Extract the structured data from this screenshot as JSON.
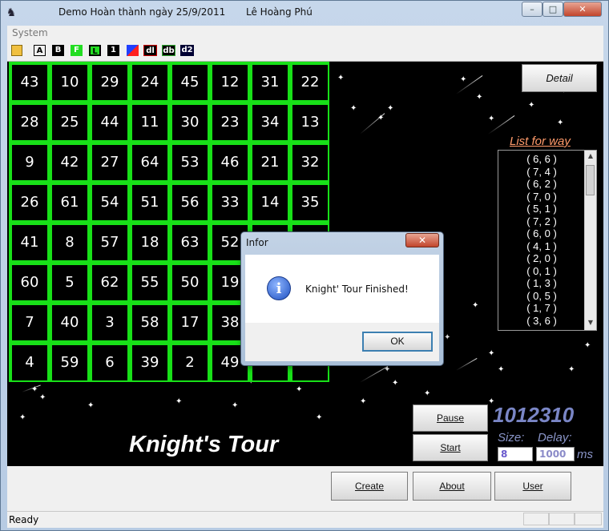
{
  "window": {
    "title_left": "Demo Hoàn thành ngày 25/9/2011",
    "title_author": "Lê Hoàng Phú",
    "minimize": "–",
    "maximize": "□",
    "close": "✕"
  },
  "menu": {
    "system": "System"
  },
  "toolbar": {
    "buttons": [
      {
        "label": "",
        "icon": "open-folder-icon"
      },
      {
        "label": "A",
        "fg": "#000000",
        "bg": "#ffffff"
      },
      {
        "label": "B",
        "fg": "#ffffff",
        "bg": "#000000"
      },
      {
        "label": "F",
        "fg": "#ffffff",
        "bg": "#22dd22"
      },
      {
        "label": "L",
        "fg": "#000000",
        "bg": "#22dd22"
      },
      {
        "label": "1",
        "fg": "#ffffff",
        "bg": "#000000"
      },
      {
        "label": "",
        "icon": "color-square-icon"
      },
      {
        "label": "dl",
        "fg": "#ffffff",
        "bg": "#990000"
      },
      {
        "label": "db",
        "fg": "#ffffff",
        "bg": "#225522"
      },
      {
        "label": "d2",
        "fg": "#ffffff",
        "bg": "#000033"
      }
    ]
  },
  "board": {
    "rows": [
      [
        43,
        10,
        29,
        24,
        45,
        12,
        31,
        22
      ],
      [
        28,
        25,
        44,
        11,
        30,
        23,
        34,
        13
      ],
      [
        9,
        42,
        27,
        64,
        53,
        46,
        21,
        32
      ],
      [
        26,
        61,
        54,
        51,
        56,
        33,
        14,
        35
      ],
      [
        41,
        8,
        57,
        18,
        63,
        52,
        "",
        ""
      ],
      [
        60,
        5,
        62,
        55,
        50,
        19,
        "",
        ""
      ],
      [
        7,
        40,
        3,
        58,
        17,
        38,
        "",
        ""
      ],
      [
        4,
        59,
        6,
        39,
        2,
        49,
        "",
        ""
      ]
    ],
    "grid_color": "#18e018"
  },
  "detail_button": "Detail",
  "list": {
    "title": "List for way",
    "items": [
      "( 6, 6 )",
      "( 7, 4 )",
      "( 6, 2 )",
      "( 7, 0 )",
      "( 5, 1 )",
      "( 7, 2 )",
      "( 6, 0 )",
      "( 4, 1 )",
      "( 2, 0 )",
      "( 0, 1 )",
      "( 1, 3 )",
      "( 0, 5 )",
      "( 1, 7 )",
      "( 3, 6 )"
    ]
  },
  "app_title": "Knight's Tour",
  "controls": {
    "pause": "Pause",
    "start": "Start",
    "counter": "1012310",
    "size_label": "Size:",
    "size_value": "8",
    "delay_label": "Delay:",
    "delay_value": "1000",
    "delay_unit": "ms"
  },
  "bottom_buttons": {
    "create": "Create",
    "about": "About",
    "user": "User"
  },
  "status": {
    "text": "Ready"
  },
  "dialog": {
    "title": "Infor",
    "message": "Knight' Tour Finished!",
    "ok": "OK",
    "close": "✕",
    "icon": "info-icon"
  }
}
